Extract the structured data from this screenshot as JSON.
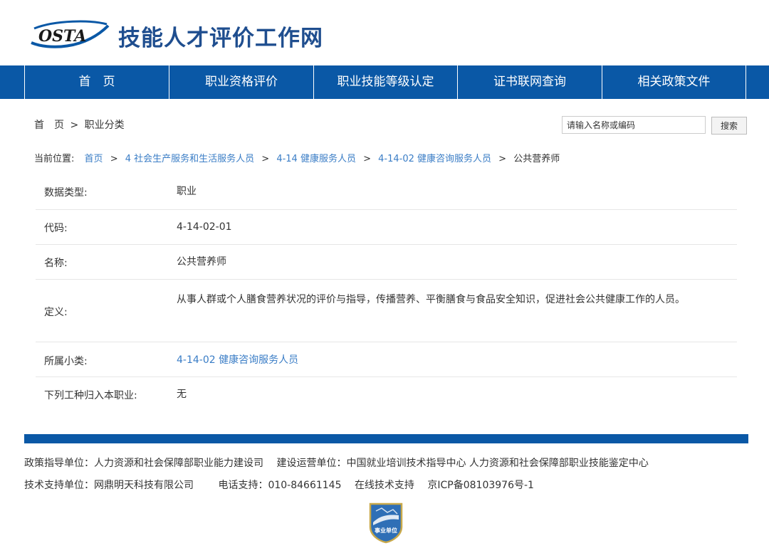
{
  "header": {
    "logo_text": "OSTA",
    "site_title": "技能人才评价工作网"
  },
  "nav": {
    "items": [
      {
        "label": "首　页"
      },
      {
        "label": "职业资格评价"
      },
      {
        "label": "职业技能等级认定"
      },
      {
        "label": "证书联网查询"
      },
      {
        "label": "相关政策文件"
      }
    ]
  },
  "breadcrumb_top": {
    "home": "首　页",
    "sep": ">",
    "current": "职业分类"
  },
  "search": {
    "value": "请输入名称或编码",
    "button_label": "搜索"
  },
  "location": {
    "prefix": "当前位置:",
    "items": [
      {
        "label": "首页"
      },
      {
        "label": "4 社会生产服务和生活服务人员"
      },
      {
        "label": "4-14 健康服务人员"
      },
      {
        "label": "4-14-02 健康咨询服务人员"
      }
    ],
    "current": "公共营养师",
    "sep": ">"
  },
  "info": {
    "rows": [
      {
        "label": "数据类型:",
        "value": "职业"
      },
      {
        "label": "代码:",
        "value": "4-14-02-01"
      },
      {
        "label": "名称:",
        "value": "公共营养师"
      },
      {
        "label": "定义:",
        "value": "从事人群或个人膳食营养状况的评价与指导，传播营养、平衡膳食与食品安全知识，促进社会公共健康工作的人员。"
      },
      {
        "label": "所属小类:",
        "value": "4-14-02 健康咨询服务人员"
      },
      {
        "label": "下列工种归入本职业:",
        "value": "无"
      }
    ]
  },
  "footer": {
    "line1": [
      "政策指导单位：人力资源和社会保障部职业能力建设司",
      "建设运营单位：中国就业培训技术指导中心 人力资源和社会保障部职业技能鉴定中心"
    ],
    "line2": [
      "技术支持单位：网鼎明天科技有限公司",
      "电话支持：010-84661145",
      "在线技术支持",
      "京ICP备08103976号-1"
    ],
    "badge_text": "事业单位"
  },
  "colors": {
    "brand_blue": "#0a58a6",
    "link_blue": "#3a7dc6",
    "title_blue": "#1f4e8f"
  }
}
